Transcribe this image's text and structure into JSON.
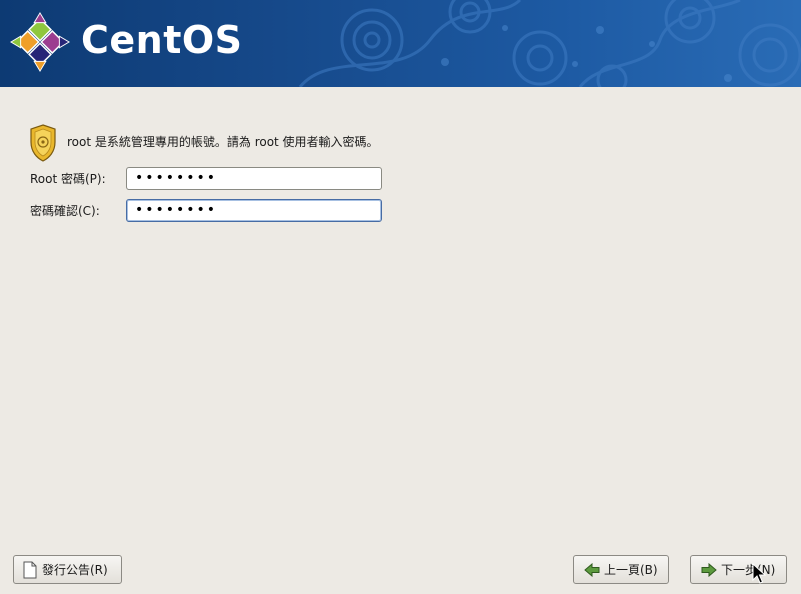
{
  "banner": {
    "brand": "CentOS",
    "colors": {
      "background": "#16498a",
      "logo_green": "#8fc73e",
      "logo_purple": "#9c3d90",
      "logo_orange": "#ef9f2a",
      "logo_blue": "#262577"
    },
    "logo_icon": "centos-logo"
  },
  "intro": {
    "icon": "security-badge-icon",
    "text": "root 是系統管理專用的帳號。請為 root 使用者輸入密碼。"
  },
  "form": {
    "password_label": "Root 密碼(P):",
    "password_value": "••••••••",
    "confirm_label": "密碼確認(C):",
    "confirm_value": "••••••••"
  },
  "buttons": {
    "release_notes": "發行公告(R)",
    "back": "上一頁(B)",
    "next": "下一步(N)"
  }
}
